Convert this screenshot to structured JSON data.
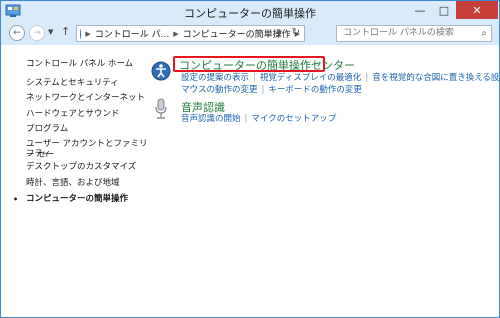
{
  "window": {
    "title": "コンピューターの簡単操作",
    "min_label": "—",
    "max_label": "□",
    "close_label": "✕"
  },
  "nav": {
    "back": "←",
    "forward": "→",
    "dropdown": "▼",
    "up": "↑",
    "breadcrumbs": [
      "コントロール パ...",
      "コンピューターの簡単操作"
    ],
    "refresh": "↻",
    "search_placeholder": "コントロール パネルの検索"
  },
  "sidebar": {
    "home": "コントロール パネル ホーム",
    "items": [
      {
        "label": "システムとセキュリティ"
      },
      {
        "label": "ネットワークとインターネット"
      },
      {
        "label": "ハードウェアとサウンド"
      },
      {
        "label": "プログラム"
      },
      {
        "label": "ユーザー アカウントとファミリー セー"
      },
      {
        "label": "フティ"
      },
      {
        "label": "デスクトップのカスタマイズ"
      },
      {
        "label": "時計、言語、および地域"
      },
      {
        "label": "コンピューターの簡単操作"
      }
    ],
    "current_bullet": "•"
  },
  "main": {
    "ease_center": {
      "title": "コンピューターの簡単操作センター",
      "links_row1": [
        "設定の提案の表示",
        "視覚ディスプレイの最適化",
        "音を視覚的な合図に置き換える設定"
      ],
      "links_row2": [
        "マウスの動作の変更",
        "キーボードの動作の変更"
      ]
    },
    "speech": {
      "title": "音声認識",
      "links": [
        "音声認識の開始",
        "マイクのセットアップ"
      ]
    }
  },
  "colors": {
    "accent": "#3c8ad0",
    "link": "#1d63b0",
    "category_title": "#1f7a3b",
    "highlight": "#e3171e"
  }
}
